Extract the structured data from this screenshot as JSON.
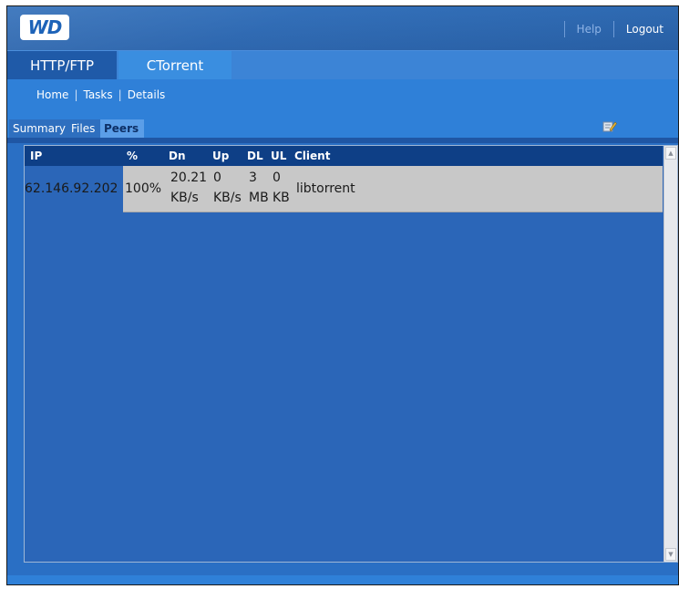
{
  "header": {
    "logo_text": "WD",
    "help_label": "Help",
    "logout_label": "Logout"
  },
  "main_tabs": [
    {
      "label": "HTTP/FTP",
      "active": false
    },
    {
      "label": "CTorrent",
      "active": true
    }
  ],
  "breadcrumb": [
    "Home",
    "Tasks",
    "Details"
  ],
  "sub_tabs": [
    {
      "label": "Summary",
      "active": false
    },
    {
      "label": "Files",
      "active": false
    },
    {
      "label": "Peers",
      "active": true
    }
  ],
  "table": {
    "columns": [
      "IP",
      "%",
      "Dn",
      "Up",
      "DL",
      "UL",
      "Client"
    ],
    "rows": [
      {
        "ip": "62.146.92.202",
        "percent": "100%",
        "dn": [
          "20.21",
          "KB/s"
        ],
        "up": [
          "0",
          "KB/s"
        ],
        "dl": [
          "3",
          "MB"
        ],
        "ul": [
          "0",
          "KB"
        ],
        "client": "libtorrent"
      }
    ]
  },
  "colors": {
    "background": "#2a6fc4",
    "header": "#2f6db8",
    "table_header": "#0e3f86",
    "row_bg": "#c8c8c8",
    "active_subtab": "#5b9ee8"
  },
  "icons": {
    "edit": "edit-icon",
    "scroll_up": "scroll-up-arrow-icon",
    "scroll_down": "scroll-down-arrow-icon"
  }
}
